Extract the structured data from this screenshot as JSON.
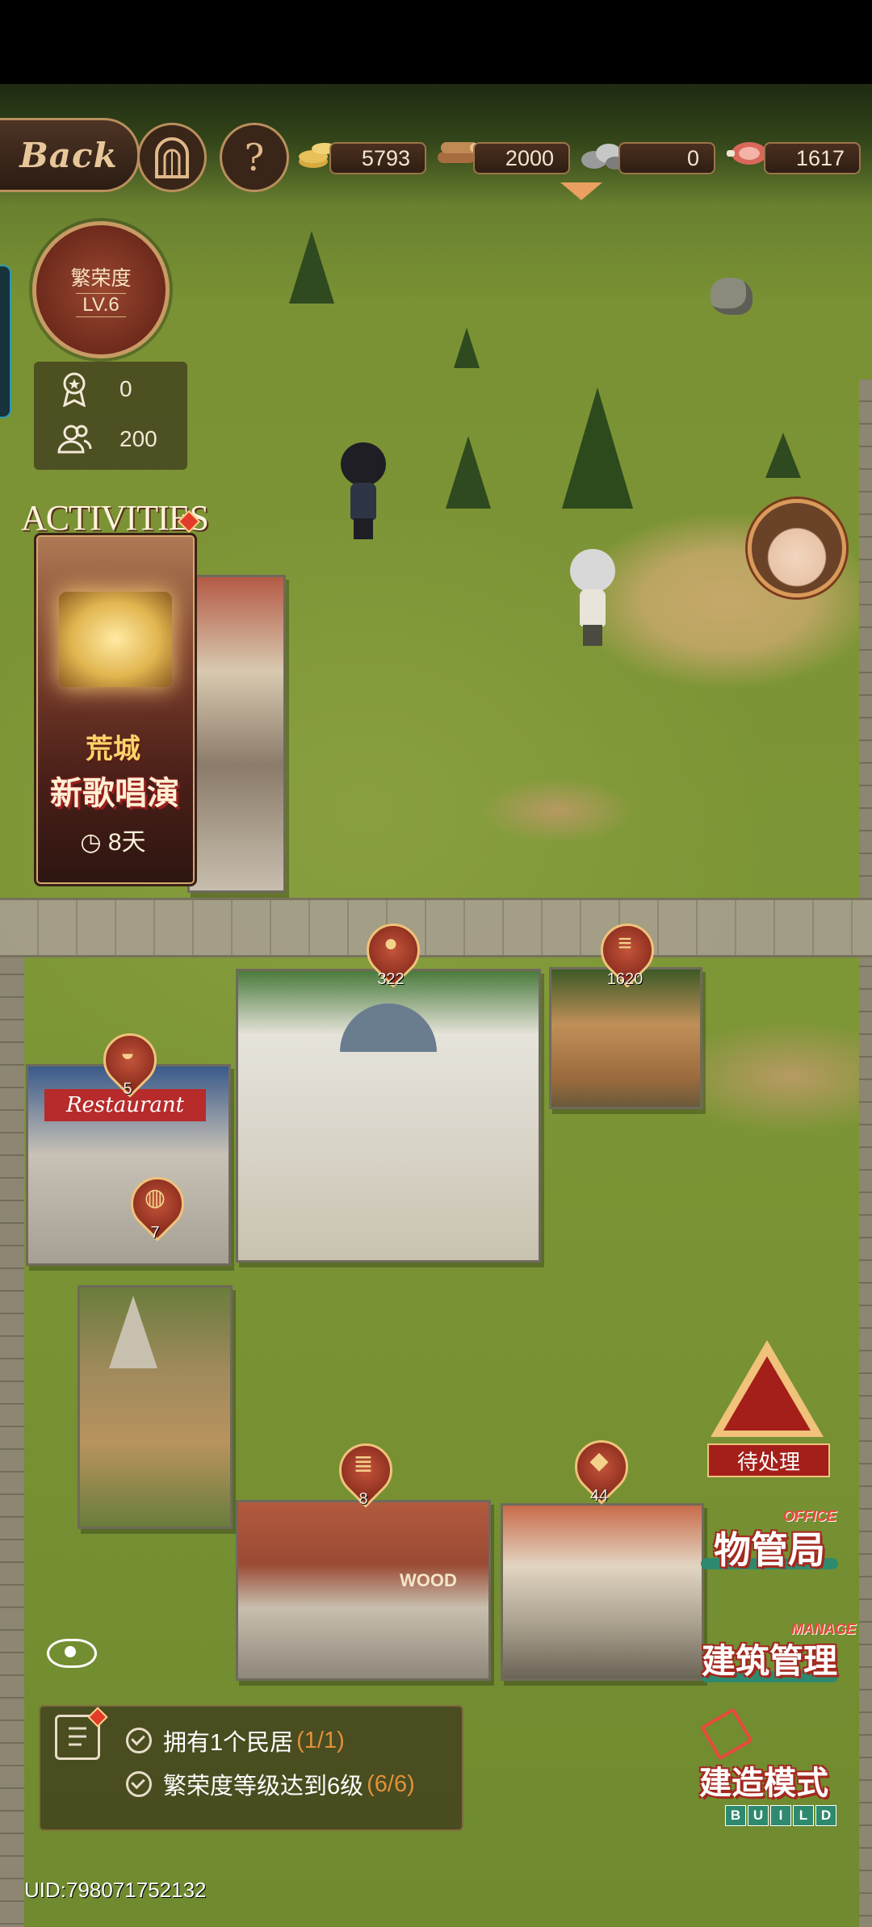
{
  "topbar": {
    "back_label": "Back",
    "help_glyph": "?",
    "resources": [
      {
        "name": "gold-coins-icon",
        "value": "5793"
      },
      {
        "name": "wood-logs-icon",
        "value": "2000"
      },
      {
        "name": "stone-icon",
        "value": "0"
      },
      {
        "name": "meat-icon",
        "value": "1617"
      }
    ]
  },
  "prosperity": {
    "title": "繁荣度",
    "level": "LV.6"
  },
  "stats": {
    "honor": "0",
    "population": "200"
  },
  "activities": {
    "label": "ACTIVITIES",
    "title_line1": "荒城",
    "title_line2": "新歌唱演",
    "timer": "8天"
  },
  "buildings": {
    "city_hall": {
      "pin_value": "322"
    },
    "lumber_camp": {
      "pin_value": "1620"
    },
    "restaurant": {
      "sign": "Restaurant",
      "pin_value": "5",
      "pin_value2": "7"
    },
    "wood_factory": {
      "sign": "WOOD",
      "pin_value": "8"
    },
    "stone_workshop": {
      "pin_value": "44"
    }
  },
  "side": {
    "pending_label": "待处理",
    "office_label": "物管局",
    "office_sub": "OFFICE",
    "manage_label": "建筑管理",
    "manage_sub": "MANAGE",
    "build_label": "建造模式",
    "build_letters": [
      "B",
      "U",
      "I",
      "L",
      "D"
    ]
  },
  "tasks": [
    {
      "text": "拥有1个民居",
      "progress": "(1/1)"
    },
    {
      "text": "繁荣度等级达到6级",
      "progress": "(6/6)"
    }
  ],
  "uid": "UID:798071752132",
  "colors": {
    "accent_gold": "#b98f5c",
    "alert_red": "#a51f1a",
    "progress_orange": "#e2913a"
  }
}
